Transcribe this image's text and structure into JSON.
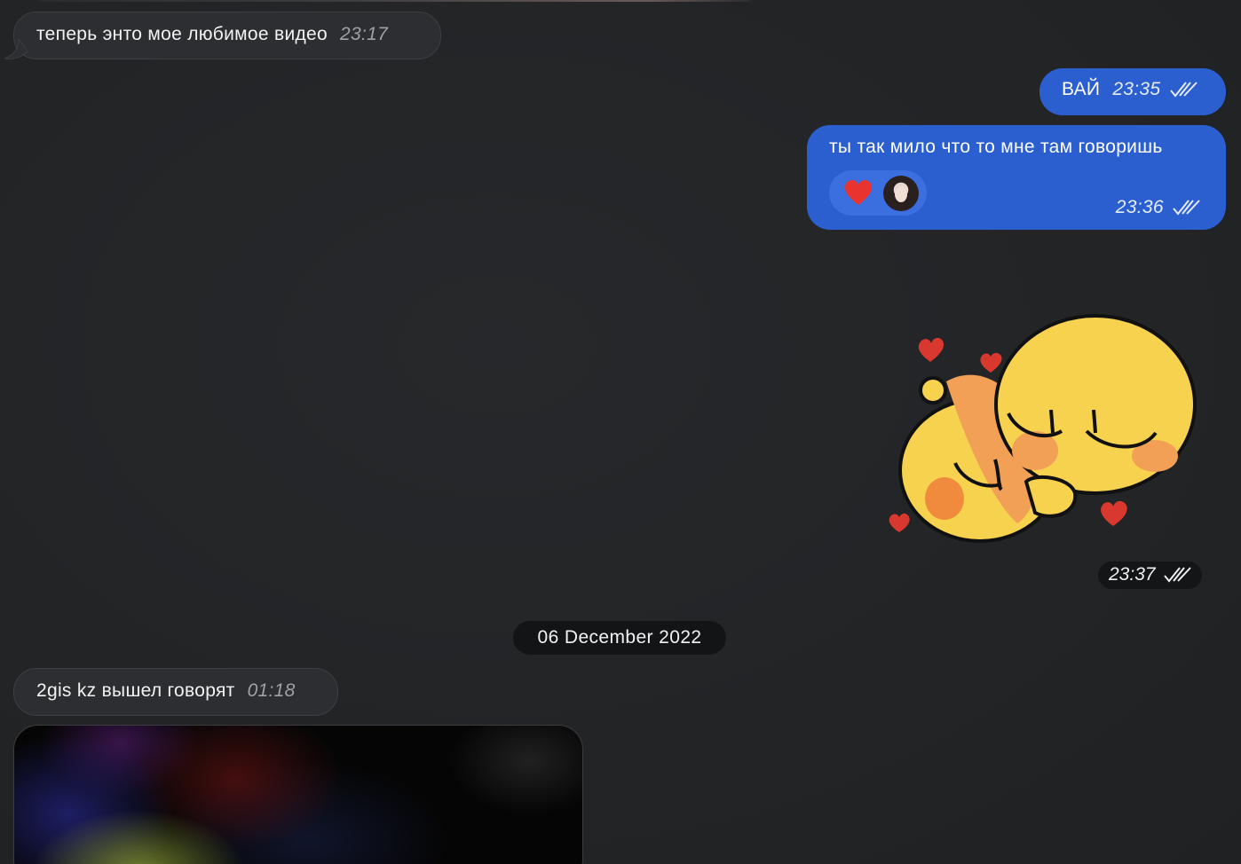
{
  "messages": {
    "m1": {
      "text": "теперь энто мое любимое видео",
      "time": "23:17"
    },
    "m2": {
      "text": "ВАЙ",
      "time": "23:35"
    },
    "m3": {
      "text": "ты так мило что то мне там говоришь",
      "time": "23:36",
      "reaction": "heart-icon"
    },
    "sticker": {
      "time": "23:37"
    },
    "date_separator": "06 December 2022",
    "m4": {
      "text": "2gis kz вышел говорят",
      "time": "01:18"
    }
  },
  "colors": {
    "background": "#222426",
    "incoming_bubble": "#2c2e31",
    "outgoing_bubble": "#2b5fd0",
    "reaction_pill": "#3b6fe0"
  }
}
